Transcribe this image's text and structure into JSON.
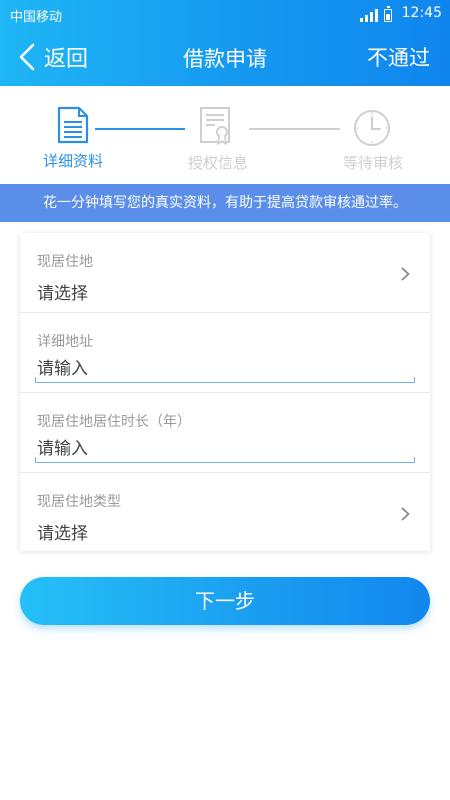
{
  "status_bar": {
    "carrier": "中国移动",
    "time": "12:45"
  },
  "nav": {
    "back_label": "返回",
    "title": "借款申请",
    "action_label": "不通过"
  },
  "steps": [
    {
      "label": "详细资料",
      "state": "active",
      "icon": "document-icon"
    },
    {
      "label": "授权信息",
      "state": "inactive",
      "icon": "certificate-icon"
    },
    {
      "label": "等待审核",
      "state": "inactive",
      "icon": "clock-icon"
    }
  ],
  "notice": "花一分钟填写您的真实资料，有助于提高贷款审核通过率。",
  "form": {
    "fields": [
      {
        "label": "现居住地",
        "value": "请选择",
        "type": "select"
      },
      {
        "label": "详细地址",
        "placeholder": "请输入",
        "type": "input"
      },
      {
        "label": "现居住地居住时长（年）",
        "placeholder": "请输入",
        "type": "input"
      },
      {
        "label": "现居住地类型",
        "value": "请选择",
        "type": "select"
      }
    ]
  },
  "next_button": "下一步",
  "colors": {
    "header_start": "#1fb6f5",
    "header_end": "#0f86ee",
    "active_step": "#2c8fe6",
    "inactive_step": "#cfcfcf",
    "notice_bg": "#5a8ee9"
  }
}
